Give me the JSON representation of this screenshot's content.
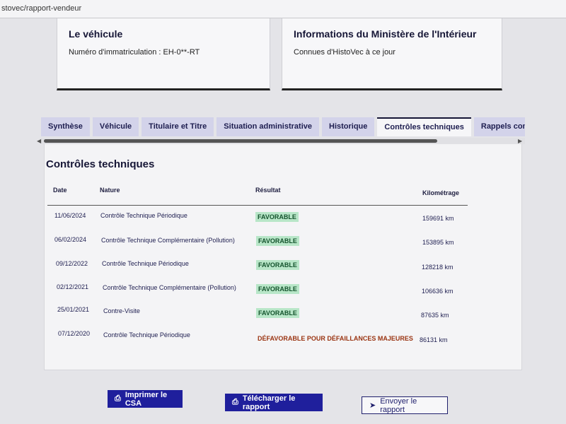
{
  "browser": {
    "url": "stovec/rapport-vendeur"
  },
  "vehicle_card": {
    "title": "Le véhicule",
    "plate_label": "Numéro d'immatriculation : EH-0**-RT"
  },
  "ministry_card": {
    "title": "Informations du Ministère de l'Intérieur",
    "subtitle": "Connues d'HistoVec à ce jour"
  },
  "tabs": [
    {
      "label": "Synthèse"
    },
    {
      "label": "Véhicule"
    },
    {
      "label": "Titulaire et Titre"
    },
    {
      "label": "Situation administrative"
    },
    {
      "label": "Historique"
    },
    {
      "label": "Contrôles techniques",
      "active": true
    },
    {
      "label": "Rappels constructeur"
    }
  ],
  "section": {
    "title": "Contrôles techniques",
    "headers": {
      "date": "Date",
      "nature": "Nature",
      "result": "Résultat",
      "mileage": "Kilométrage"
    },
    "rows": [
      {
        "date": "11/06/2024",
        "nature": "Contrôle Technique Périodique",
        "result": "FAVORABLE",
        "mileage": "159691 km"
      },
      {
        "date": "06/02/2024",
        "nature": "Contrôle Technique Complémentaire (Pollution)",
        "result": "FAVORABLE",
        "mileage": "153895 km"
      },
      {
        "date": "09/12/2022",
        "nature": "Contrôle Technique Périodique",
        "result": "FAVORABLE",
        "mileage": "128218 km"
      },
      {
        "date": "02/12/2021",
        "nature": "Contrôle Technique Complémentaire (Pollution)",
        "result": "FAVORABLE",
        "mileage": "106636 km"
      },
      {
        "date": "25/01/2021",
        "nature": "Contre-Visite",
        "result": "FAVORABLE",
        "mileage": "87635 km"
      },
      {
        "date": "07/12/2020",
        "nature": "Contrôle Technique Périodique",
        "result": "DÉFAVORABLE POUR DÉFAILLANCES MAJEURES",
        "mileage": "86131 km"
      }
    ]
  },
  "actions": {
    "print_label": "Imprimer le CSA",
    "download_label": "Télécharger le rapport",
    "send_label": "Envoyer le rapport"
  },
  "colors": {
    "primary": "#1f1f9c",
    "favorable_bg": "#b8e6c8",
    "unfavorable": "#9a3412"
  },
  "icons": {
    "print": "printer-icon",
    "send": "send-icon"
  }
}
